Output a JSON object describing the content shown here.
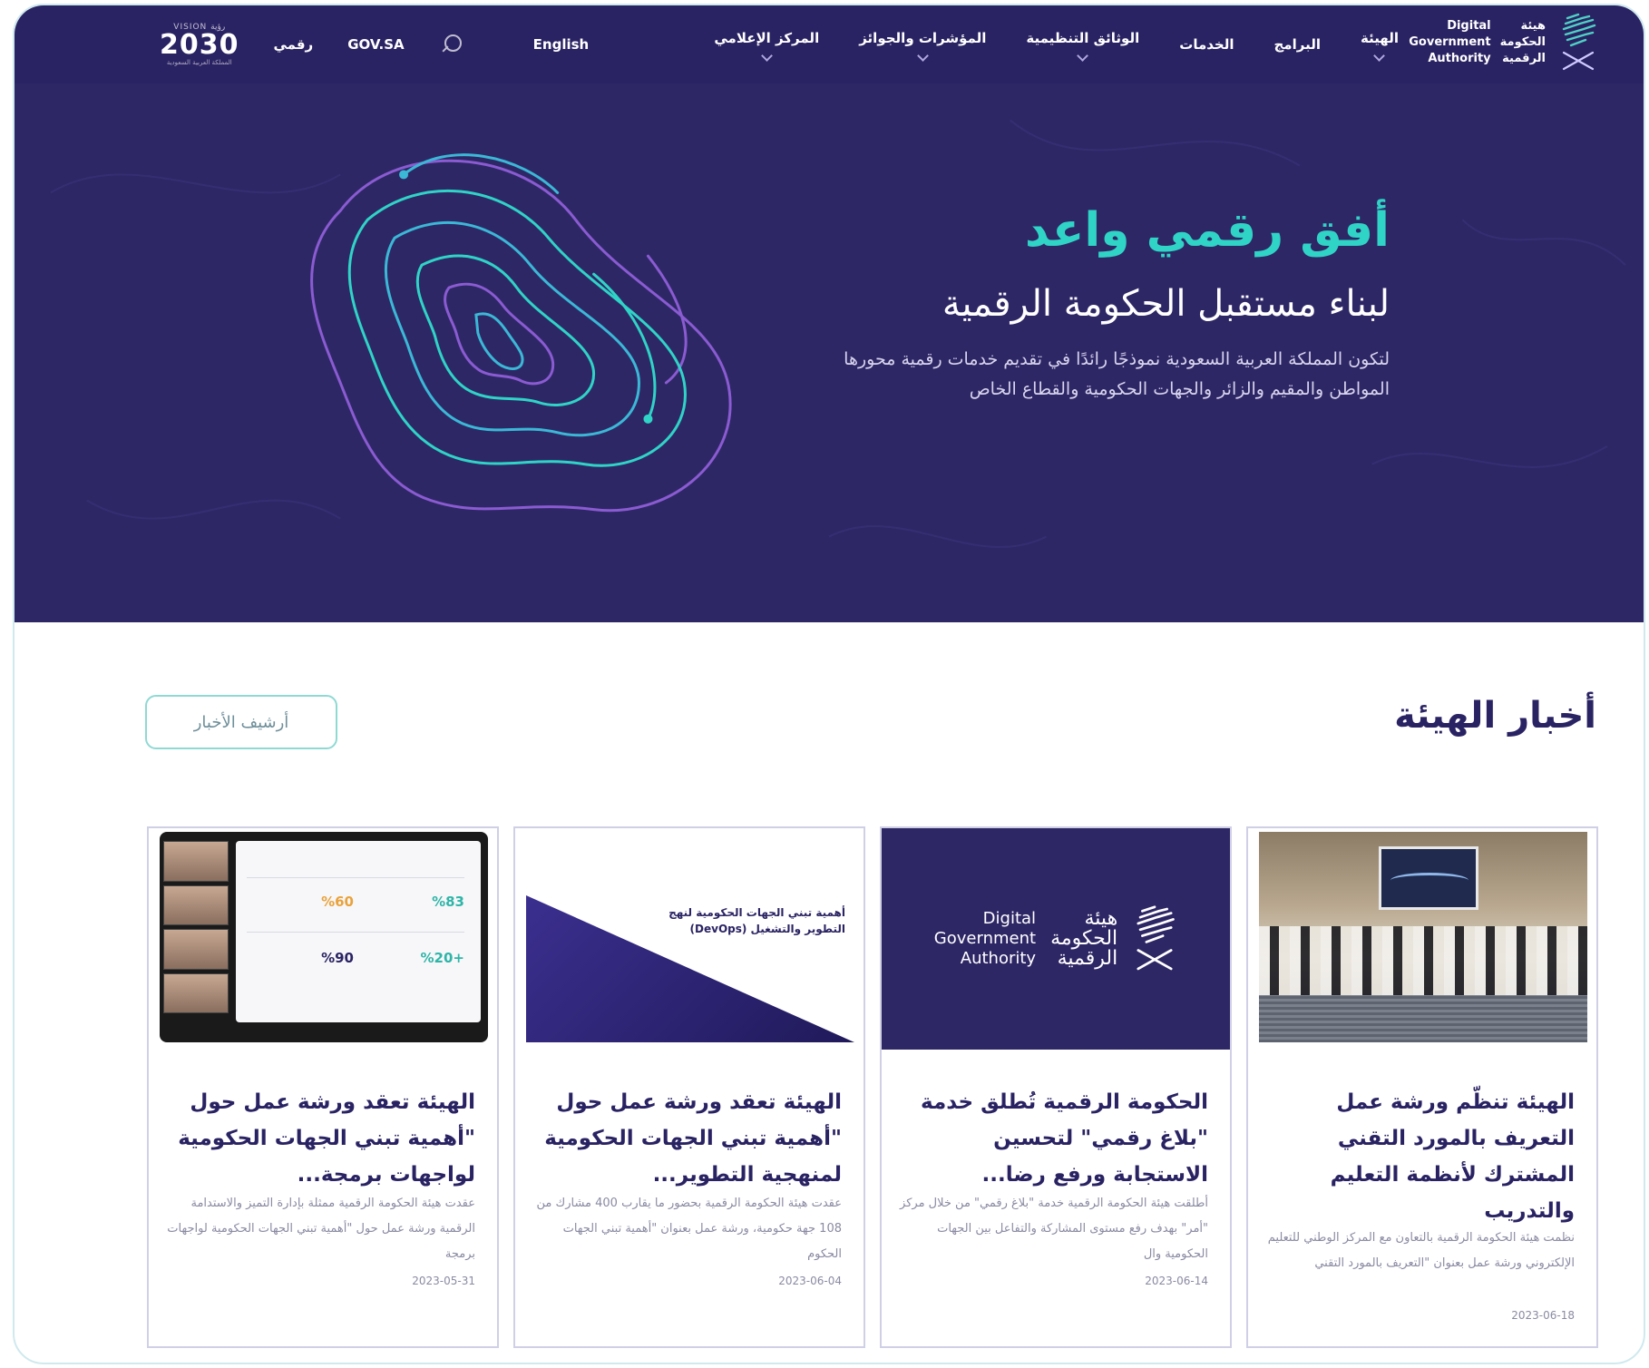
{
  "header": {
    "vision_logo": {
      "top": "VISION رؤية",
      "number": "2030",
      "sub": "المملكة العربية السعودية"
    },
    "links": {
      "raqmi": "رقمي",
      "govsa": "GOV.SA",
      "english": "English"
    },
    "menu": [
      {
        "label": "الهيئة",
        "has_dropdown": true
      },
      {
        "label": "البرامج",
        "has_dropdown": false
      },
      {
        "label": "الخدمات",
        "has_dropdown": false
      },
      {
        "label": "الوثائق التنظيمية",
        "has_dropdown": true
      },
      {
        "label": "المؤشرات والجوائز",
        "has_dropdown": true
      },
      {
        "label": "المركز الإعلامي",
        "has_dropdown": true
      }
    ],
    "brand": {
      "ar_1": "هيئة",
      "ar_2": "الحكومة",
      "ar_3": "الرقمية",
      "en_1": "Digital",
      "en_2": "Government",
      "en_3": "Authority"
    }
  },
  "hero": {
    "title": "أفق رقمي واعد",
    "subtitle": "لبناء مستقبل الحكومة الرقمية",
    "description": "لتكون المملكة العربية السعودية نموذجًا رائدًا في تقديم خدمات رقمية محورها المواطن والمقيم والزائر والجهات الحكومية والقطاع الخاص",
    "colors": {
      "background": "#2e2766",
      "accent": "#2fd4c6",
      "purple": "#8a5bd1"
    }
  },
  "news": {
    "title": "أخبار الهيئة",
    "archive_button": "أرشيف الأخبار",
    "cards": [
      {
        "title": "الهيئة تنظّم ورشة عمل التعريف بالمورد التقني المشترك لأنظمة التعليم والتدريب",
        "body": "نظمت هيئة الحكومة الرقمية بالتعاون مع المركز الوطني للتعليم الإلكتروني ورشة عمل بعنوان \"التعريف بالمورد التقني",
        "date": "2023-06-18",
        "thumb": "photo"
      },
      {
        "title": "الحكومة الرقمية تُطلق خدمة \"بلاغ رقمي\" لتحسين الاستجابة ورفع رضا...",
        "body": "أطلقت هيئة الحكومة الرقمية خدمة \"بلاغ رقمي\" من خلال مركز \"أمر\" بهدف رفع مستوى المشاركة والتفاعل بين الجهات الحكومية وال",
        "date": "2023-06-14",
        "thumb": "logo"
      },
      {
        "title": "الهيئة تعقد ورشة عمل حول \"أهمية تبني الجهات الحكومية لمنهجية التطوير...",
        "body": "عقدت هيئة الحكومة الرقمية بحضور ما يقارب 400 مشارك من 108 جهة حكومية، ورشة عمل بعنوان \"أهمية تبني الجهات الحكوم",
        "date": "2023-06-04",
        "thumb": "devops",
        "thumb_text": "أهمية تبني الجهات الحكومية لنهج التطوير والتشغيل (DevOps)"
      },
      {
        "title": "الهيئة تعقد ورشة عمل حول \"أهمية تبني الجهات الحكومية لواجهات برمجة...",
        "body": "عقدت هيئة الحكومة الرقمية ممثلة بإدارة التميز والاستدامة الرقمية ورشة عمل حول \"أهمية تبني الجهات الحكومية لواجهات برمجة",
        "date": "2023-05-31",
        "thumb": "meeting",
        "stats": [
          "%83",
          "%60",
          "%20+",
          "%90"
        ]
      }
    ]
  }
}
